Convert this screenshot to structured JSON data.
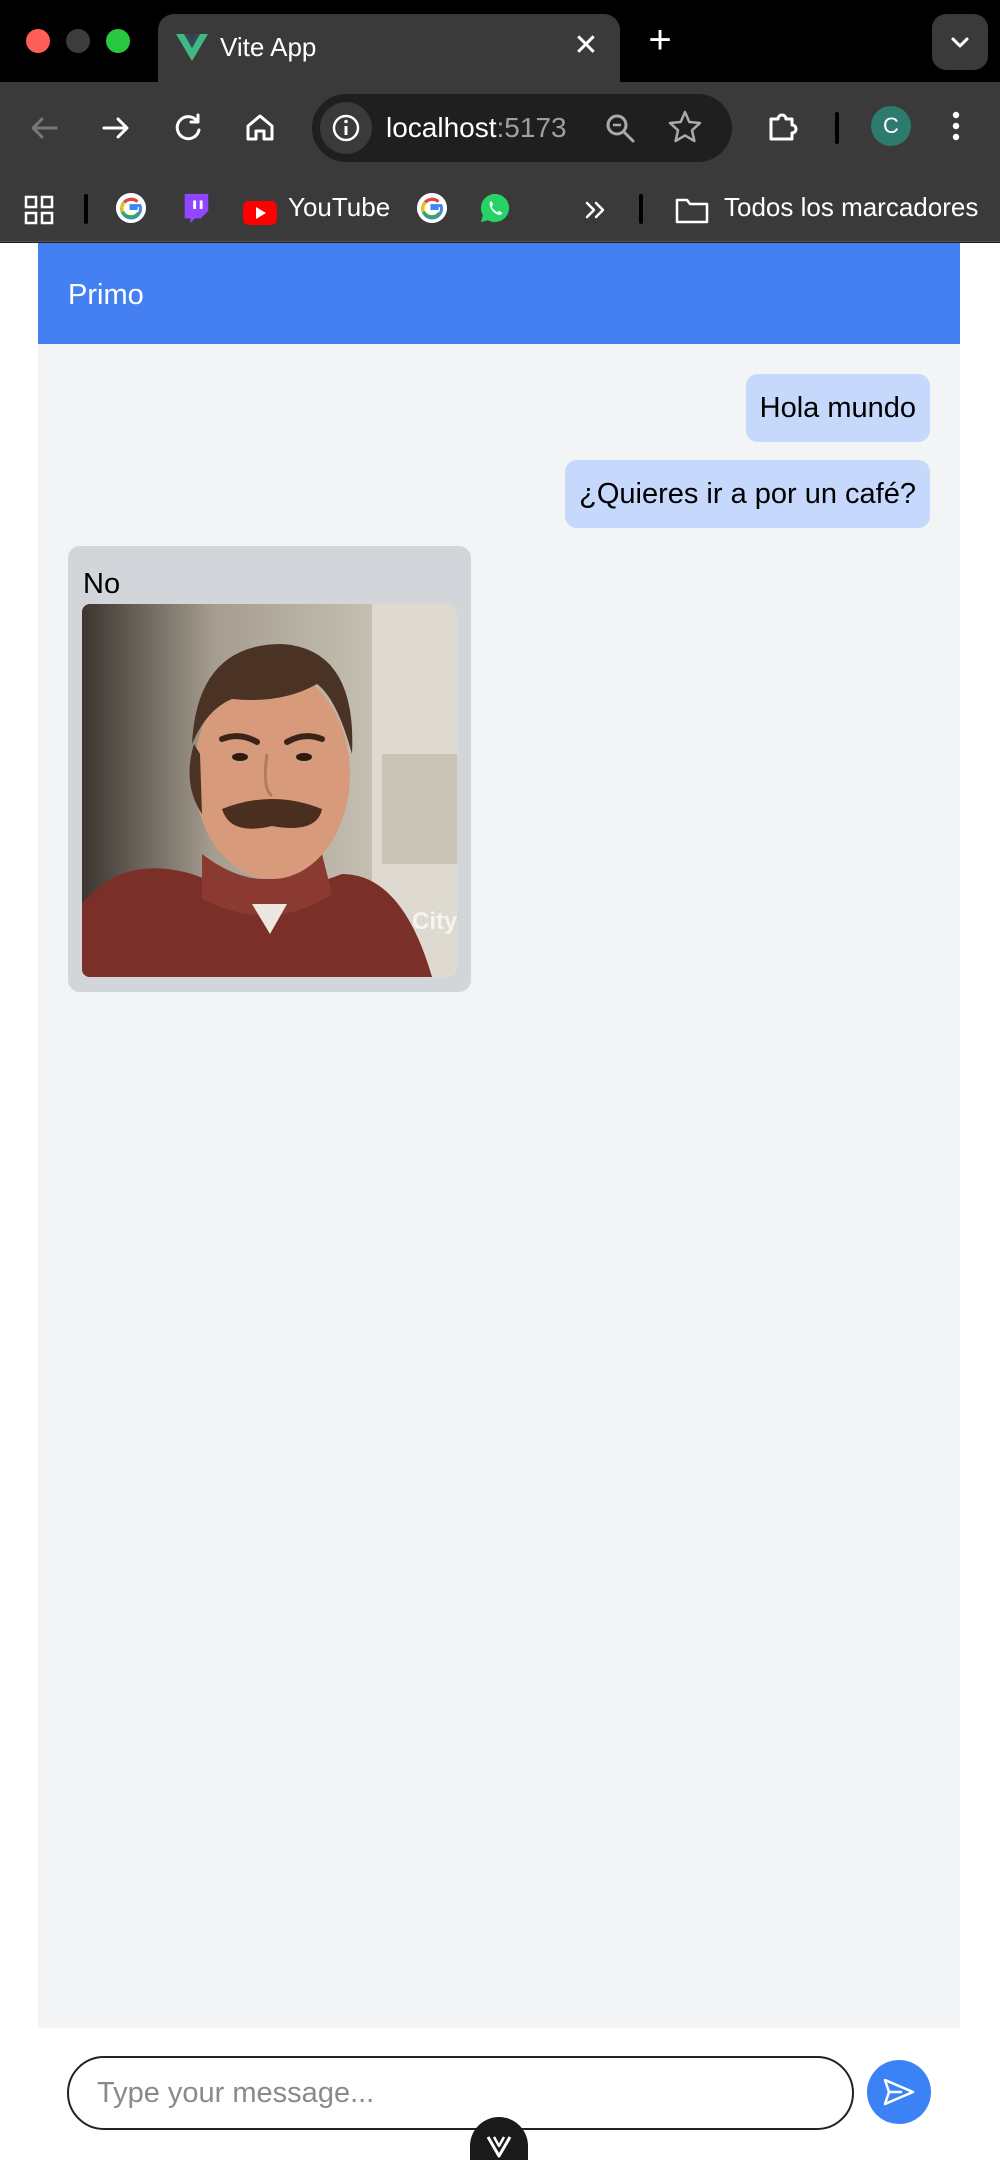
{
  "browser": {
    "tab": {
      "title": "Vite App",
      "favicon": "vue-logo-icon"
    },
    "address": {
      "host": "localhost",
      "port": ":5173"
    },
    "profile_initial": "C",
    "bookmarks": [
      {
        "name": "google",
        "label": ""
      },
      {
        "name": "twitch",
        "label": ""
      },
      {
        "name": "youtube",
        "label": "YouTube"
      },
      {
        "name": "google-2",
        "label": ""
      },
      {
        "name": "whatsapp",
        "label": ""
      }
    ],
    "all_bookmarks_label": "Todos los marcadores"
  },
  "chat": {
    "header_title": "Primo",
    "messages": [
      {
        "direction": "sent",
        "text": "Hola mundo"
      },
      {
        "direction": "sent",
        "text": "¿Quieres ir a por un café?"
      },
      {
        "direction": "received",
        "text": "No",
        "has_image": true,
        "image_watermark": "City"
      }
    ],
    "composer": {
      "placeholder": "Type your message..."
    }
  },
  "colors": {
    "header": "#4580f2",
    "sent_bubble": "#c6d8fb",
    "received_bubble": "#d2d5da",
    "send_button": "#3b82f6",
    "chat_background": "#f3f4f6"
  }
}
